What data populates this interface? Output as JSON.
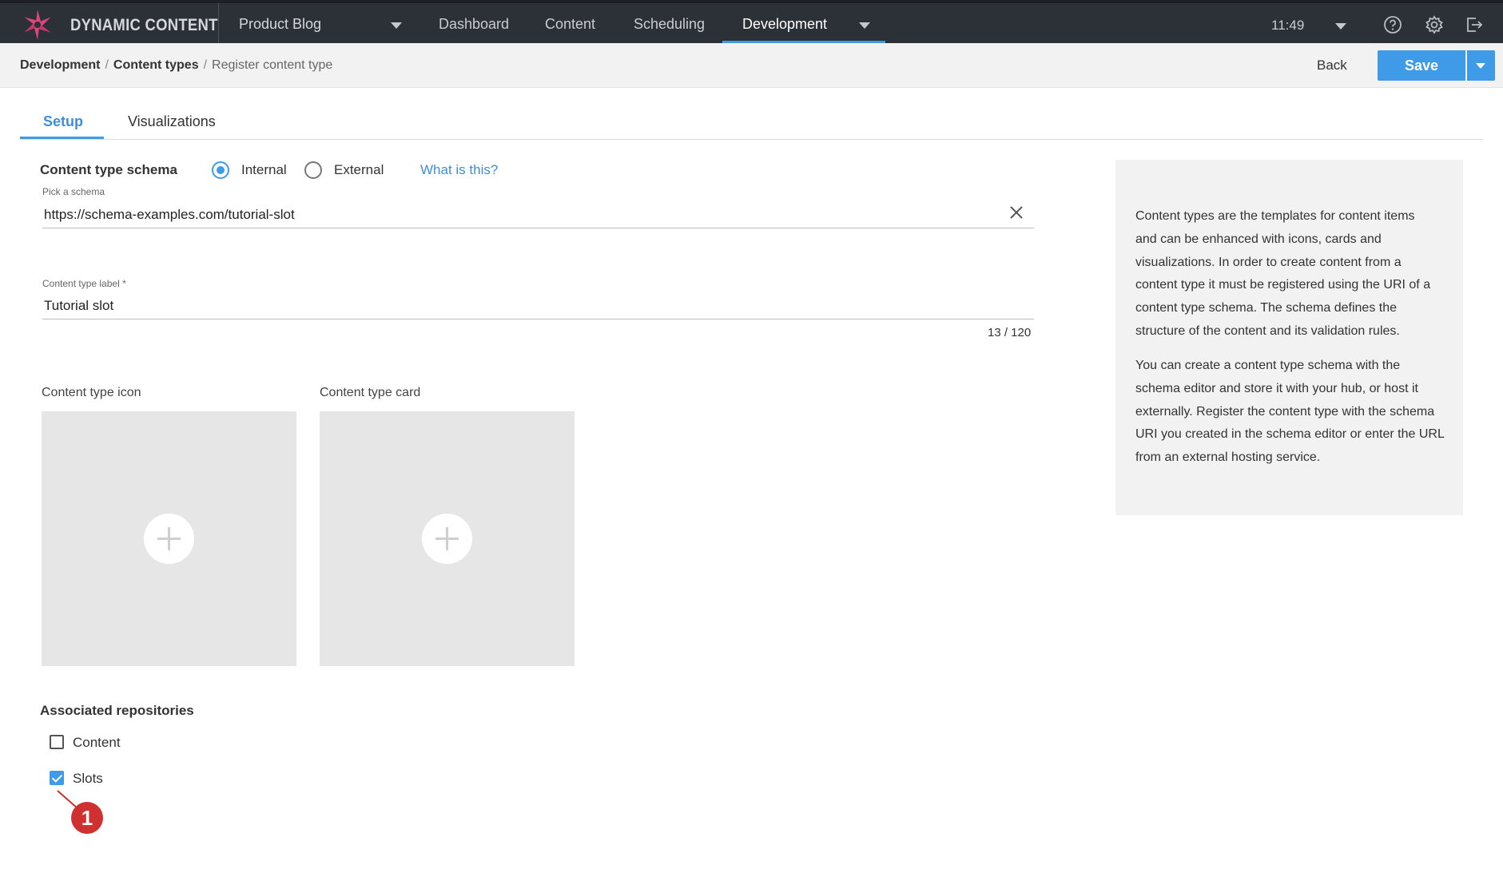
{
  "app": {
    "brand": "DYNAMIC CONTENT"
  },
  "topnav": {
    "hub": "Product Blog",
    "items": [
      {
        "label": "Dashboard"
      },
      {
        "label": "Content"
      },
      {
        "label": "Scheduling"
      },
      {
        "label": "Development"
      }
    ],
    "active": "Development",
    "time": "11:49",
    "icons": [
      "help-icon",
      "gear-icon",
      "logout-icon"
    ]
  },
  "breadcrumb": {
    "items": [
      "Development",
      "Content types",
      "Register content type"
    ],
    "back_label": "Back",
    "save_label": "Save"
  },
  "tabs": [
    {
      "label": "Setup",
      "active": true
    },
    {
      "label": "Visualizations",
      "active": false
    }
  ],
  "schema": {
    "title": "Content type schema",
    "options": [
      {
        "label": "Internal",
        "checked": true
      },
      {
        "label": "External",
        "checked": false
      }
    ],
    "help_link": "What is this?",
    "pick_caption": "Pick a schema",
    "pick_value": "https://schema-examples.com/tutorial-slot"
  },
  "label_field": {
    "caption": "Content type label *",
    "value": "Tutorial slot",
    "counter": "13 / 120"
  },
  "media": {
    "icon_label": "Content type icon",
    "card_label": "Content type card"
  },
  "repositories": {
    "title": "Associated repositories",
    "items": [
      {
        "label": "Content",
        "checked": false
      },
      {
        "label": "Slots",
        "checked": true
      }
    ]
  },
  "callout": {
    "number": "1"
  },
  "info": {
    "paragraphs": [
      [
        "Content types are the templates for content items",
        "and can be enhanced with icons, cards and",
        "visualizations. In order to create content from a",
        "content type it must be registered using the URI of a",
        "content type schema. The schema defines the",
        "structure of the content and its validation rules."
      ],
      [
        "You can create a content type schema with the",
        "schema editor and store it with your hub, or host it",
        "externally. Register the content type with the schema",
        "URI you created in the schema editor or enter the URL",
        "from an external hosting service."
      ]
    ]
  },
  "colors": {
    "accent": "#3f9ae8",
    "topbar": "#2c3138",
    "callout": "#d0302f"
  }
}
